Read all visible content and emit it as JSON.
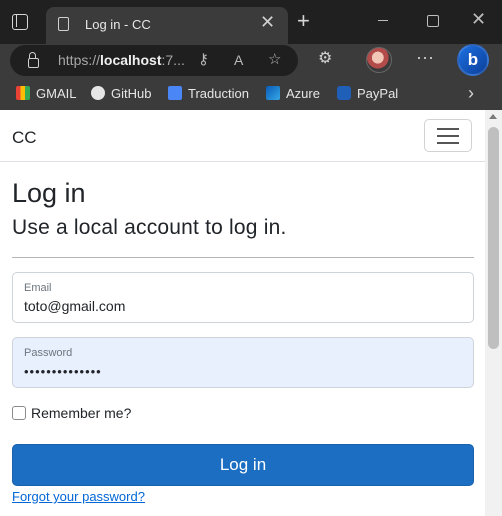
{
  "browser": {
    "tab_title": "Log in - CC",
    "url_host": "localhost",
    "url_prefix": "https://",
    "url_suffix": ":7...",
    "bookmarks": [
      "GMAIL",
      "GitHub",
      "Traduction",
      "Azure",
      "PayPal"
    ]
  },
  "page": {
    "brand": "CC",
    "title": "Log in",
    "subtitle": "Use a local account to log in.",
    "email_label": "Email",
    "email_value": "toto@gmail.com",
    "password_label": "Password",
    "password_value": "••••••••••••••",
    "remember_label": "Remember me?",
    "login_button": "Log in",
    "forgot_link": "Forgot your password?"
  }
}
